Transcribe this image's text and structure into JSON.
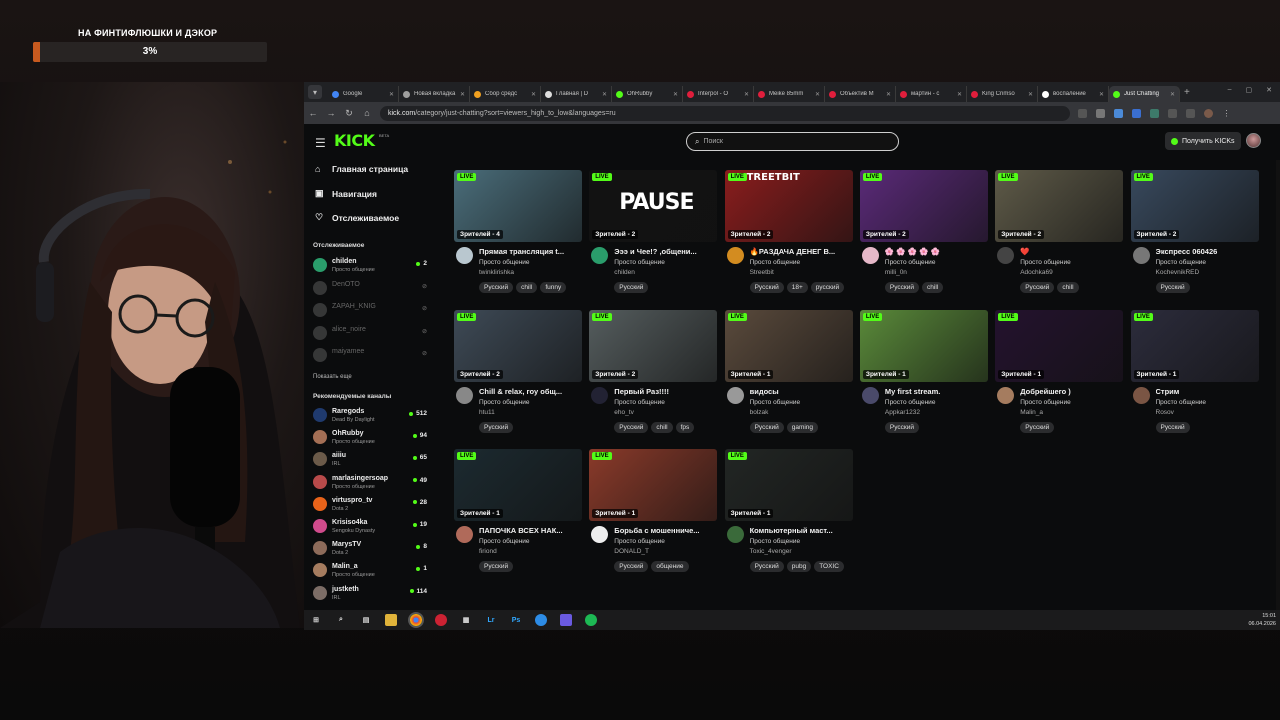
{
  "overlay": {
    "goal_title": "НА ФИНТИФЛЮШКИ И ДЭКОР",
    "goal_percent": "3%",
    "goal_fraction": 0.03,
    "fill_color": "#c85a1f"
  },
  "browser": {
    "tabs": [
      {
        "label": "Google",
        "fav": "#4285f4",
        "active": false
      },
      {
        "label": "Новая вкладка",
        "fav": "#9e9e9e",
        "active": false
      },
      {
        "label": "Сбор средс",
        "fav": "#f0a020",
        "active": false
      },
      {
        "label": "Главная | D",
        "fav": "#dddddd",
        "active": false
      },
      {
        "label": "OhRubby",
        "fav": "#53fc18",
        "active": false
      },
      {
        "label": "Interpol - O",
        "fav": "#e01e3c",
        "active": false
      },
      {
        "label": "Meike 85mm",
        "fav": "#e01e3c",
        "active": false
      },
      {
        "label": "Объектив M",
        "fav": "#e01e3c",
        "active": false
      },
      {
        "label": "мартин - с",
        "fav": "#e01e3c",
        "active": false
      },
      {
        "label": "King Crimso",
        "fav": "#e01e3c",
        "active": false
      },
      {
        "label": "воспаление",
        "fav": "#ffffff",
        "active": false
      },
      {
        "label": "Just Chatting",
        "fav": "#53fc18",
        "active": true
      }
    ],
    "url_domain": "kick.com",
    "url_path": "/category/just-chatting?sort=viewers_high_to_low&languages=ru"
  },
  "kick": {
    "logo": "KICK",
    "logo_beta": "BETA",
    "search_placeholder": "Поиск",
    "get_kicks_label": "Получить KICKs",
    "brand_color": "#53fc18",
    "nav": {
      "home": "Главная страница",
      "browse": "Навигация",
      "following": "Отслеживаемое"
    },
    "following_header": "Отслеживаемое",
    "following": [
      {
        "name": "childen",
        "sub": "Просто общение",
        "viewers": "2",
        "online": true,
        "color": "#2a9d6b"
      },
      {
        "name": "DenOTO",
        "sub": "",
        "viewers": "",
        "online": false,
        "color": "#777"
      },
      {
        "name": "ZAPAH_KNIG",
        "sub": "",
        "viewers": "",
        "online": false,
        "color": "#777"
      },
      {
        "name": "alice_noire",
        "sub": "",
        "viewers": "",
        "online": false,
        "color": "#777"
      },
      {
        "name": "maiyamee",
        "sub": "",
        "viewers": "",
        "online": false,
        "color": "#777"
      }
    ],
    "show_more": "Показать еще",
    "recommended_header": "Рекомендуемые каналы",
    "recommended": [
      {
        "name": "Raregods",
        "sub": "Dead By Daylight",
        "viewers": "512",
        "color": "#1f3a6e"
      },
      {
        "name": "OhRubby",
        "sub": "Просто общение",
        "viewers": "94",
        "color": "#a46f55"
      },
      {
        "name": "aiiiu",
        "sub": "IRL",
        "viewers": "65",
        "color": "#6b5a49"
      },
      {
        "name": "marlasingersoap",
        "sub": "Просто общение",
        "viewers": "49",
        "color": "#b84a4a"
      },
      {
        "name": "virtuspro_tv",
        "sub": "Dota 2",
        "viewers": "28",
        "color": "#e8631a"
      },
      {
        "name": "Krisiso4ka",
        "sub": "Sengoku Dynasty",
        "viewers": "19",
        "color": "#d04b8c"
      },
      {
        "name": "MarysTV",
        "sub": "Dota 2",
        "viewers": "8",
        "color": "#8d6b5a"
      },
      {
        "name": "Malin_a",
        "sub": "Просто общение",
        "viewers": "1",
        "color": "#a57c5f"
      },
      {
        "name": "justketh",
        "sub": "IRL",
        "viewers": "114",
        "color": "#7c6d66"
      }
    ],
    "live_label": "LIVE",
    "streams": [
      {
        "title": "Прямая трансляция t...",
        "category": "Просто общение",
        "user": "twinklirishka",
        "viewers": "Зрителей - 4",
        "tags": [
          "Русский",
          "chill",
          "funny"
        ],
        "thumb": "#4a6d7a",
        "av": "#b9c7cf"
      },
      {
        "title": "Эээ и Чее!? ,общени...",
        "category": "Просто общение",
        "user": "childen",
        "viewers": "Зрителей - 2",
        "tags": [
          "Русский"
        ],
        "thumb": "#121212",
        "av": "#2a9d6b",
        "thumb_text": "PAUSE"
      },
      {
        "title": "🔥РАЗДАЧА ДЕНЕГ В...",
        "category": "Просто общение",
        "user": "Streetbit",
        "viewers": "Зрителей - 2",
        "tags": [
          "Русский",
          "18+",
          "русский"
        ],
        "thumb": "#8a1d1d",
        "av": "#d38c20",
        "thumb_text": "TREETBIT"
      },
      {
        "title": "🌸 🌸 🌸 🌸 🌸",
        "category": "Просто общение",
        "user": "milli_0n",
        "viewers": "Зрителей - 2",
        "tags": [
          "Русский",
          "chill"
        ],
        "thumb": "#5a2a78",
        "av": "#e6b8c8"
      },
      {
        "title": "❤️",
        "category": "Просто общение",
        "user": "Adochka69",
        "viewers": "Зрителей - 2",
        "tags": [
          "Русский",
          "chill"
        ],
        "thumb": "#5e5a48",
        "av": "#444"
      },
      {
        "title": "Экспресс 060426",
        "category": "Просто общение",
        "user": "KochevnikRED",
        "viewers": "Зрителей - 2",
        "tags": [
          "Русский"
        ],
        "thumb": "#38495d",
        "av": "#777"
      },
      {
        "title": "Chill & relax, гоу общ...",
        "category": "Просто общение",
        "user": "htu11",
        "viewers": "Зрителей - 2",
        "tags": [
          "Русский"
        ],
        "thumb": "#3e4a56",
        "av": "#888"
      },
      {
        "title": "Первый Раз!!!!",
        "category": "Просто общение",
        "user": "eho_tv",
        "viewers": "Зрителей - 2",
        "tags": [
          "Русский",
          "chill",
          "fps"
        ],
        "thumb": "#555d5e",
        "av": "#223"
      },
      {
        "title": "видосы",
        "category": "Просто общение",
        "user": "bolzak",
        "viewers": "Зрителей - 1",
        "tags": [
          "Русский",
          "gaming"
        ],
        "thumb": "#5a4a3c",
        "av": "#999"
      },
      {
        "title": "My first stream.",
        "category": "Просто общение",
        "user": "Appkar1232",
        "viewers": "Зрителей - 1",
        "tags": [
          "Русский"
        ],
        "thumb": "#5a8a3a",
        "av": "#4a4a6a"
      },
      {
        "title": "Добрейшего )",
        "category": "Просто общение",
        "user": "Malin_a",
        "viewers": "Зрителей - 1",
        "tags": [
          "Русский"
        ],
        "thumb": "#24122e",
        "av": "#a57c5f"
      },
      {
        "title": "Стрим",
        "category": "Просто общение",
        "user": "Rosov",
        "viewers": "Зрителей - 1",
        "tags": [
          "Русский"
        ],
        "thumb": "#2c2c3c",
        "av": "#7a5544"
      },
      {
        "title": "ПАПОЧКА ВСЕХ НАК...",
        "category": "Просто общение",
        "user": "firiond",
        "viewers": "Зрителей - 1",
        "tags": [
          "Русский"
        ],
        "thumb": "#1c2a30",
        "av": "#b06a5a"
      },
      {
        "title": "Борьба с мошенниче...",
        "category": "Просто общение",
        "user": "DONALD_T",
        "viewers": "Зрителей - 1",
        "tags": [
          "Русский",
          "общение"
        ],
        "thumb": "#8a3a2a",
        "av": "#eee"
      },
      {
        "title": "Компьютерный маст...",
        "category": "Просто общение",
        "user": "Toxic_4venger",
        "viewers": "Зрителей - 1",
        "tags": [
          "Русский",
          "pubg",
          "TOXIC"
        ],
        "thumb": "#222624",
        "av": "#3a6a3a"
      }
    ]
  },
  "taskbar": {
    "time": "15:01",
    "date": "06.04.2026"
  }
}
